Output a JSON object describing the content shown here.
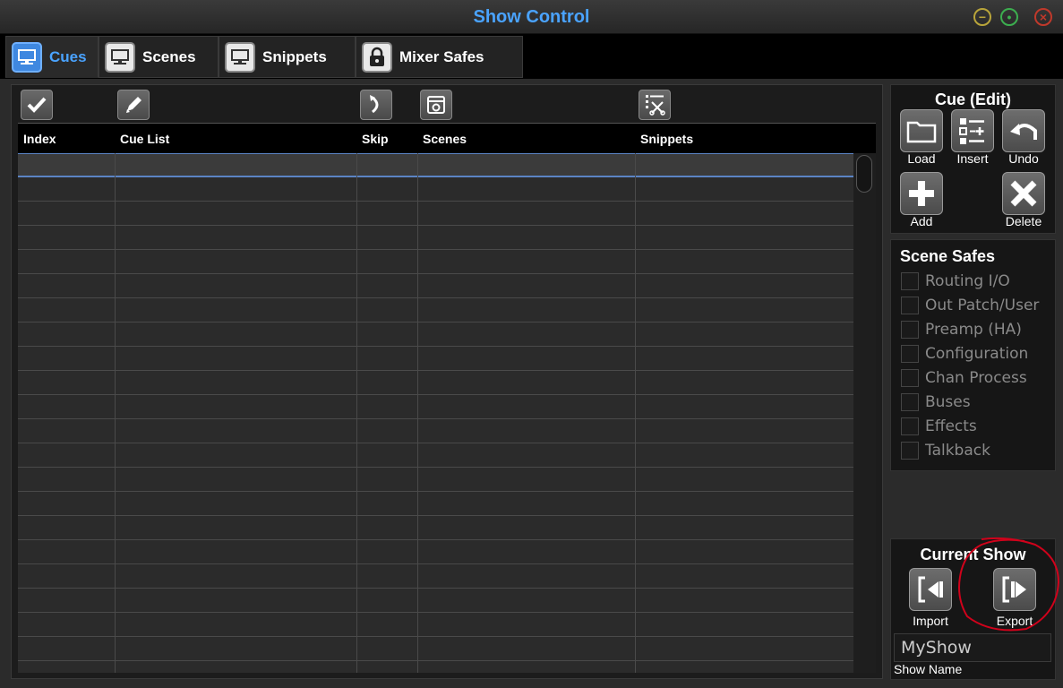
{
  "window": {
    "title": "Show Control",
    "controls": [
      "minimize-icon",
      "maximize-icon",
      "close-icon"
    ]
  },
  "tabs": [
    {
      "label": "Cues",
      "icon": "monitor-icon",
      "active": true
    },
    {
      "label": "Scenes",
      "icon": "monitor-icon",
      "active": false
    },
    {
      "label": "Snippets",
      "icon": "monitor-icon",
      "active": false
    },
    {
      "label": "Mixer Safes",
      "icon": "lock-icon",
      "active": false
    }
  ],
  "grid": {
    "column_tools": [
      "checkmark-icon",
      "pencil-icon",
      "skip-arrow-icon",
      "scene-settings-icon",
      "snippet-cut-icon"
    ],
    "columns": [
      "Index",
      "Cue List",
      "Skip",
      "Scenes",
      "Snippets"
    ],
    "row_count": 22,
    "selected_row": 0
  },
  "cue_edit": {
    "title": "Cue (Edit)",
    "buttons": [
      {
        "label": "Load",
        "icon": "folder-icon"
      },
      {
        "label": "Insert",
        "icon": "insert-list-icon"
      },
      {
        "label": "Undo",
        "icon": "undo-icon"
      },
      {
        "label": "Add",
        "icon": "plus-icon"
      },
      {
        "label": "Delete",
        "icon": "x-icon"
      }
    ]
  },
  "scene_safes": {
    "title": "Scene Safes",
    "items": [
      {
        "label": "Routing I/O",
        "checked": false
      },
      {
        "label": "Out Patch/User",
        "checked": false
      },
      {
        "label": "Preamp (HA)",
        "checked": false
      },
      {
        "label": "Configuration",
        "checked": false
      },
      {
        "label": "Chan Process",
        "checked": false
      },
      {
        "label": "Buses",
        "checked": false
      },
      {
        "label": "Effects",
        "checked": false
      },
      {
        "label": "Talkback",
        "checked": false
      }
    ]
  },
  "current_show": {
    "title": "Current Show",
    "import_label": "Import",
    "export_label": "Export",
    "show_name_value": "MyShow",
    "show_name_label": "Show Name",
    "annotation_color": "#d0021b"
  },
  "colors": {
    "accent": "#4aa3ff",
    "selection": "#5b84c4"
  }
}
